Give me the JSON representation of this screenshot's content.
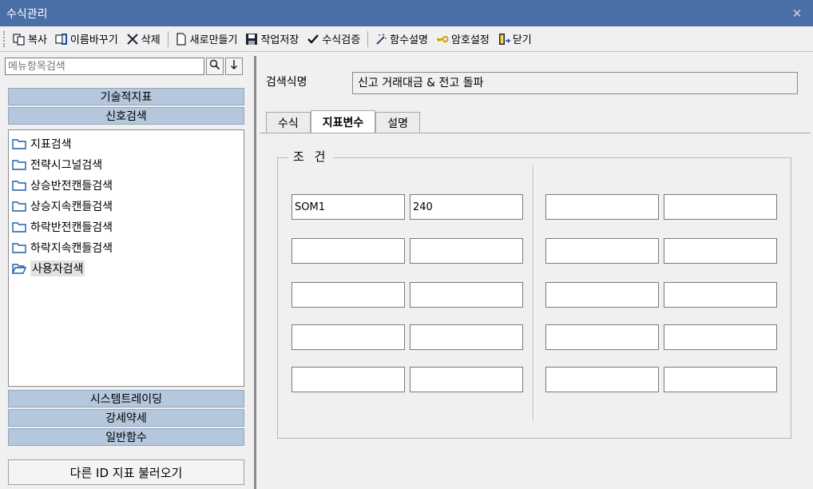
{
  "window": {
    "title": "수식관리"
  },
  "toolbar": {
    "copy": "복사",
    "rename": "이름바꾸기",
    "delete": "삭제",
    "new": "새로만들기",
    "save": "작업저장",
    "validate": "수식검증",
    "func_desc": "함수설명",
    "password": "암호설정",
    "close": "닫기"
  },
  "left": {
    "search_placeholder": "메뉴항목검색",
    "categories_top": [
      "기술적지표",
      "신호검색"
    ],
    "tree": [
      "지표검색",
      "전략시그널검색",
      "상승반전캔들검색",
      "상승지속캔들검색",
      "하락반전캔들검색",
      "하락지속캔들검색",
      "사용자검색"
    ],
    "selected_tree_item": "사용자검색",
    "categories_bottom": [
      "시스템트레이딩",
      "강세약세",
      "일반함수"
    ],
    "load_button": "다른 ID 지표 불러오기"
  },
  "right": {
    "formula_name_label": "검색식명",
    "formula_name_value": "신고 거래대금 & 전고 돌파",
    "tabs": [
      "수식",
      "지표변수",
      "설명"
    ],
    "active_tab": "지표변수",
    "group_label": "조 건",
    "left_cells": [
      [
        "SOM1",
        "240"
      ],
      [
        "",
        ""
      ],
      [
        "",
        ""
      ],
      [
        "",
        ""
      ],
      [
        "",
        ""
      ]
    ],
    "right_cells": [
      [
        "",
        ""
      ],
      [
        "",
        ""
      ],
      [
        "",
        ""
      ],
      [
        "",
        ""
      ],
      [
        "",
        ""
      ]
    ]
  },
  "colors": {
    "titlebar": "#4a6ea6",
    "category_bar": "#b4c7dc"
  }
}
